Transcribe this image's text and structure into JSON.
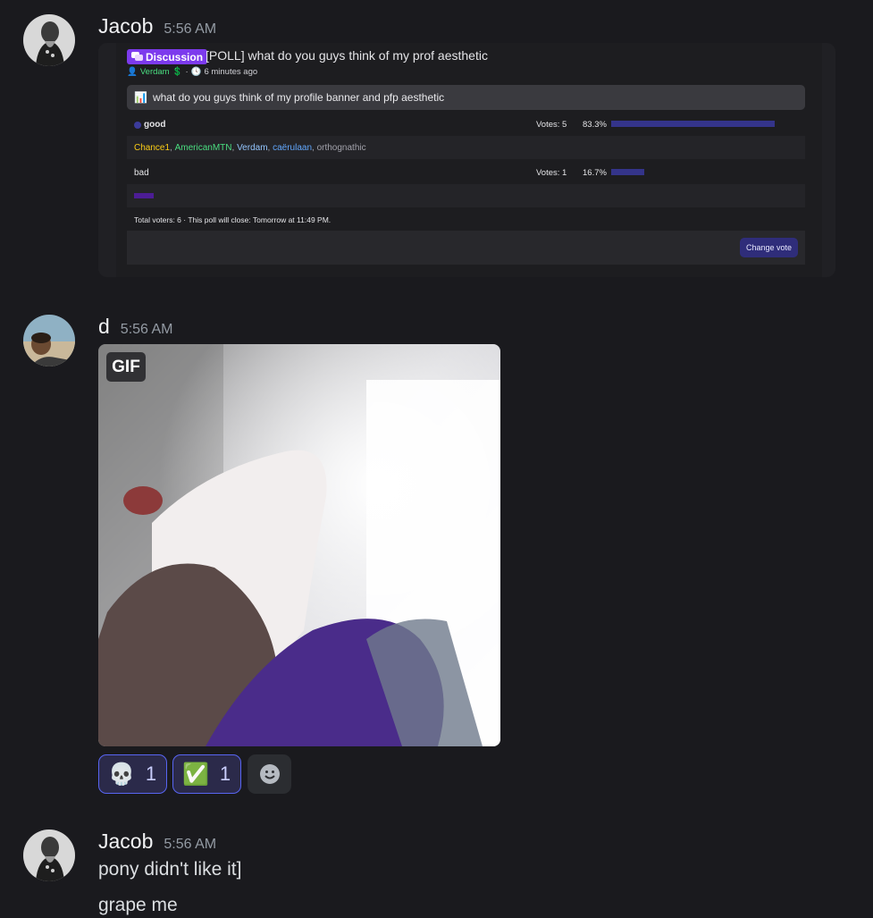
{
  "messages": [
    {
      "username": "Jacob",
      "timestamp": "5:56 AM",
      "poll": {
        "tag": "Discussion",
        "thread_title": "[POLL] what do you guys think of my prof aesthetic",
        "author": "Verdam",
        "author_badge": "💲",
        "age": "6 minutes ago",
        "question": "what do you guys think of my profile banner and pfp aesthetic",
        "options": [
          {
            "label": "good",
            "votes_text": "Votes: 5",
            "pct_text": "83.3%",
            "pct": 83.3
          },
          {
            "label": "bad",
            "votes_text": "Votes: 1",
            "pct_text": "16.7%",
            "pct": 16.7
          }
        ],
        "voters_good": [
          {
            "name": "Chance1",
            "color": "#facc15"
          },
          {
            "name": "AmericanMTN",
            "color": "#4ade80"
          },
          {
            "name": "Verdam",
            "color": "#93c5fd"
          },
          {
            "name": "caërulaan",
            "color": "#60a5fa"
          },
          {
            "name": "orthognathic",
            "color": "#a1a1aa"
          }
        ],
        "voters_bad_color": "#4c1d95",
        "footer": "Total voters: 6 · This poll will close: Tomorrow at 11:49 PM.",
        "change_vote": "Change vote"
      }
    },
    {
      "username": "d",
      "timestamp": "5:56 AM",
      "gif_badge": "GIF",
      "reactions": [
        {
          "emoji": "💀",
          "count": "1"
        },
        {
          "emoji": "✅",
          "count": "1"
        }
      ]
    },
    {
      "username": "Jacob",
      "timestamp": "5:56 AM",
      "lines": [
        "pony didn't like it]",
        "grape me"
      ]
    }
  ]
}
